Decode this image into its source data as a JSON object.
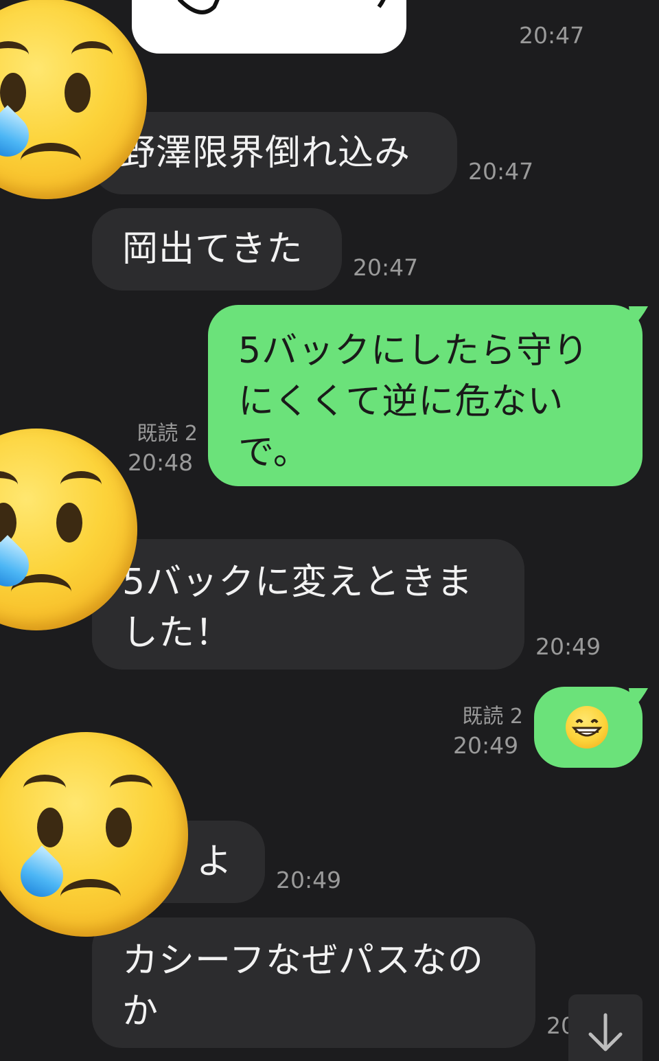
{
  "messages": [
    {
      "text": "野澤限界倒れ込み",
      "time": "20:47"
    },
    {
      "text": "岡出てきた",
      "time": "20:47"
    },
    {
      "text": "5バックにしたら守りにくくて逆に危ないで。",
      "read": "既読 2",
      "time": "20:48"
    },
    {
      "text": "5バックに変えときました！",
      "time": "20:49"
    },
    {
      "emoji": "grinning-face",
      "read": "既読 2",
      "time": "20:49"
    },
    {
      "text": "よ",
      "time": "20:49"
    },
    {
      "text": "カシーフなぜパスなのか",
      "time": "20"
    }
  ],
  "sticker": {
    "time": "20:47"
  },
  "colors": {
    "background": "#1c1c1e",
    "incoming_bubble": "#2c2c2e",
    "outgoing_bubble": "#6be27a"
  },
  "icons": {
    "scroll_down": "arrow-down-icon",
    "overlay": "crying-face-emoji"
  }
}
